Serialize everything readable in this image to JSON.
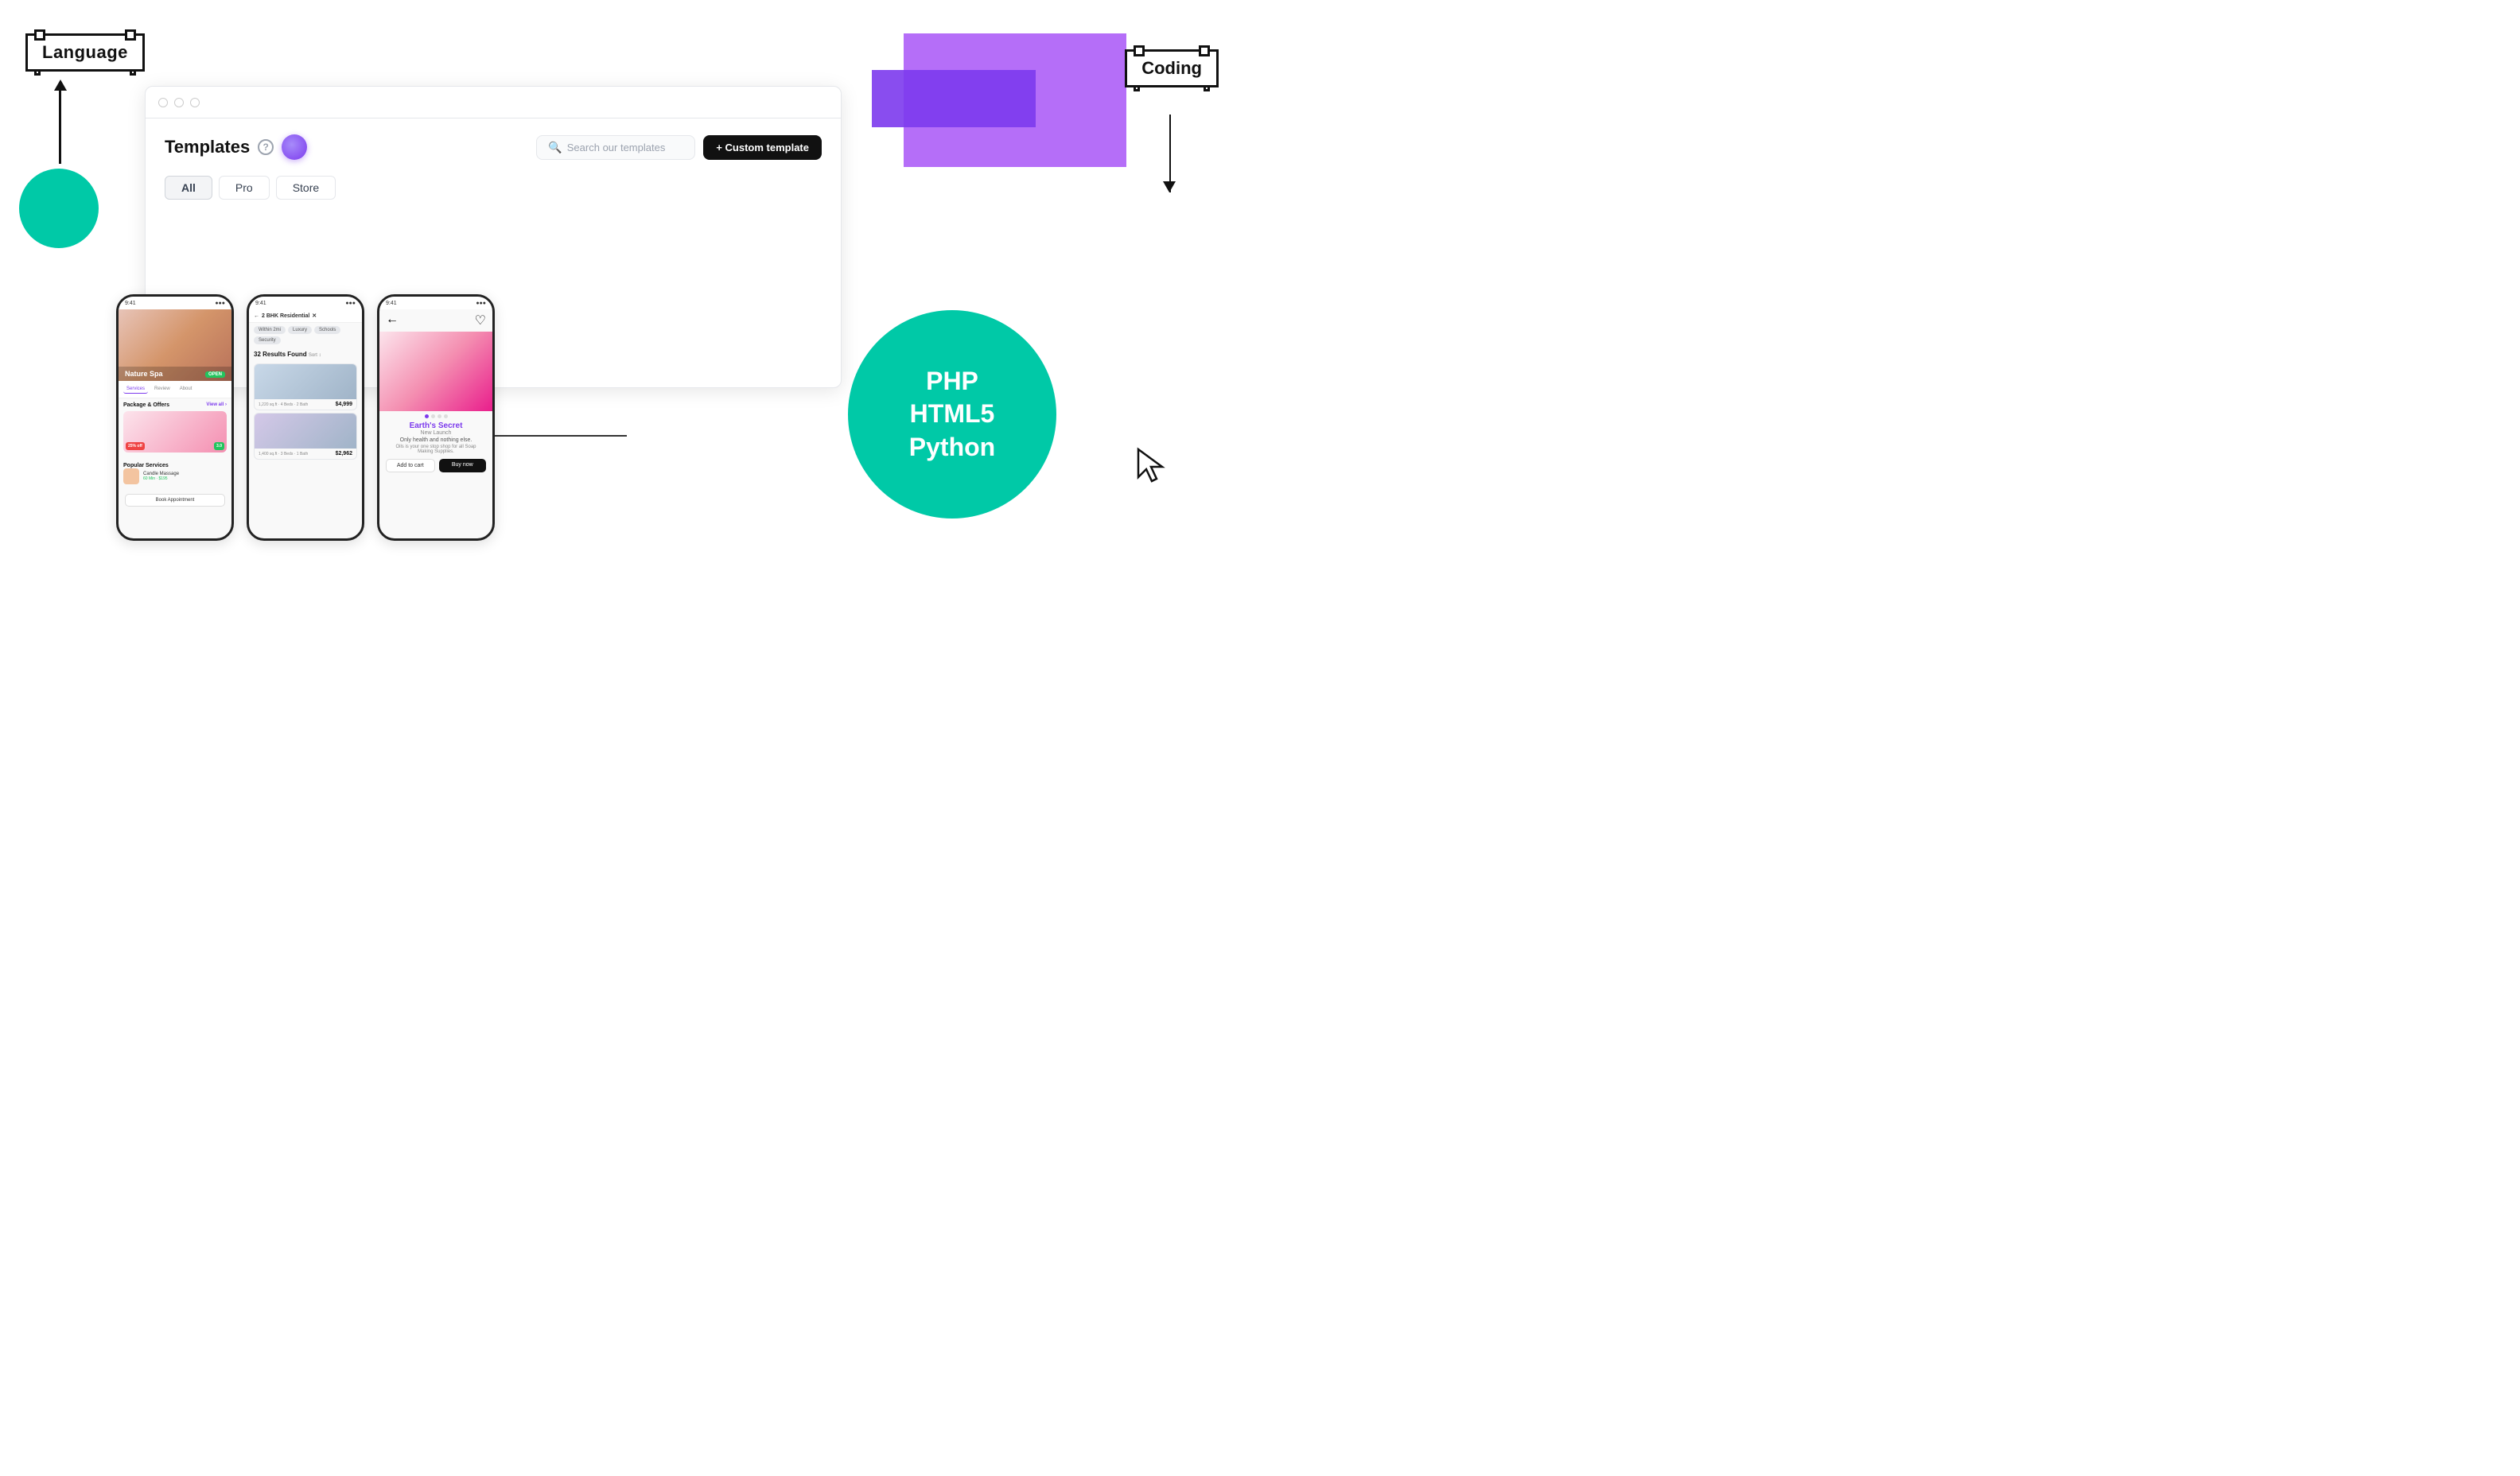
{
  "language_label": "Language",
  "coding_label": "Coding",
  "browser": {
    "title": "Templates",
    "question_icon": "?",
    "search_placeholder": "Search our templates",
    "custom_template_btn": "+ Custom template",
    "tabs": [
      "All",
      "Pro",
      "Store"
    ]
  },
  "tech_circle": {
    "lines": [
      "PHP",
      "HTML5",
      "Python"
    ]
  },
  "phones": [
    {
      "id": "phone1",
      "status_time": "9:41",
      "title": "Nature Spa",
      "open_label": "OPEN",
      "tabs": [
        "Services",
        "Review",
        "About"
      ],
      "section_title": "Package & Offers",
      "view_all": "View all",
      "discount": "25% off",
      "green_pct": "3.0",
      "popular_title": "Popular Services",
      "service_name": "Candle Massage",
      "service_duration": "60 Min",
      "service_price": "$195",
      "book_label": "Book Appointment"
    },
    {
      "id": "phone2",
      "status_time": "9:41",
      "location": "2 BHK Residential",
      "tags": [
        "Within 2mi",
        "Luxury",
        "Schools",
        "Security"
      ],
      "results_label": "32 Results Found",
      "sort_label": "Sort",
      "properties": [
        {
          "size": "1,220 sq.ft",
          "beds": "4 Beds",
          "bath": "2 Bath",
          "price": "$4,999"
        },
        {
          "size": "1,400 sq.ft",
          "beds": "3 Beds",
          "bath": "1 Bath",
          "price": "$2,962"
        }
      ]
    },
    {
      "id": "phone3",
      "status_time": "9:41",
      "brand": "Earth's Secret",
      "launch": "New Launch",
      "tagline": "Only health and nothing else.",
      "sub": "Oils is your one stop shop for all Soap Making Supplies.",
      "cart_label": "Add to cart",
      "buy_label": "Buy now"
    }
  ]
}
